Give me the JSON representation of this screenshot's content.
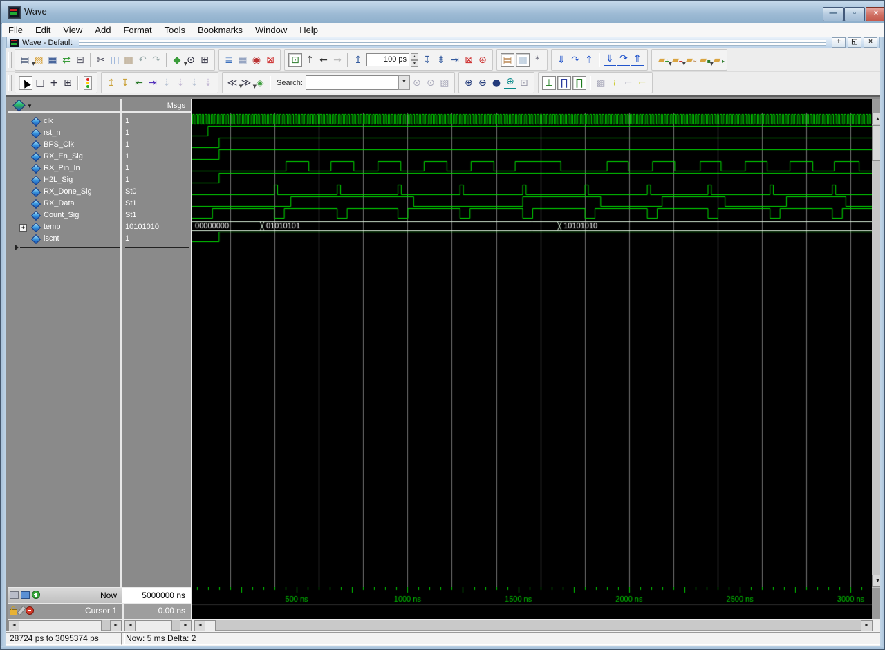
{
  "window": {
    "title": "Wave",
    "buttons": {
      "minimize": "—",
      "maximize": "▫",
      "close": "×"
    }
  },
  "menu": {
    "items": [
      "File",
      "Edit",
      "View",
      "Add",
      "Format",
      "Tools",
      "Bookmarks",
      "Window",
      "Help"
    ]
  },
  "mdi": {
    "title": "Wave - Default",
    "buttons": {
      "dock": "+",
      "undock": "◱",
      "close": "×"
    }
  },
  "toolbar1": [
    {
      "items": [
        {
          "n": "new-file-icon",
          "g": "▤",
          "c": "#4a5a7a",
          "dd": true
        },
        {
          "n": "open-icon",
          "g": "▨",
          "c": "#d49a2a"
        },
        {
          "n": "save-icon",
          "g": "▦",
          "c": "#2d4f8e"
        },
        {
          "n": "reload-icon",
          "g": "⇄",
          "c": "#3a9c3a"
        },
        {
          "n": "print-icon",
          "g": "⊟",
          "c": "#556"
        },
        {
          "sep": true
        },
        {
          "n": "cut-icon",
          "g": "✂",
          "c": "#445"
        },
        {
          "n": "copy-icon",
          "g": "◫",
          "c": "#3a6fbd"
        },
        {
          "n": "paste-icon",
          "g": "▥",
          "c": "#8a6a3a"
        },
        {
          "n": "undo-icon",
          "g": "↶",
          "c": "#9aa"
        },
        {
          "n": "redo-icon",
          "g": "↷",
          "c": "#9aa"
        },
        {
          "sep": true
        },
        {
          "n": "compile-icon",
          "g": "◆",
          "c": "#3a9c3a",
          "dd": true
        },
        {
          "n": "find-icon",
          "g": "⊙",
          "c": "#223"
        },
        {
          "n": "expand-hierarchy-icon",
          "g": "⊞",
          "c": "#334"
        }
      ]
    },
    {
      "items": [
        {
          "n": "add-to-wave-icon",
          "g": "≣",
          "c": "#3a6fbd"
        },
        {
          "n": "pattern-wizard-icon",
          "g": "▦",
          "c": "#8899bb"
        },
        {
          "n": "export-waveform-icon",
          "g": "◉",
          "c": "#b33"
        },
        {
          "n": "delete-wave-icon",
          "g": "⊠",
          "c": "#c22"
        }
      ]
    },
    {
      "items": [
        {
          "n": "link-icon",
          "g": "⊡",
          "c": "#2a7a2a",
          "box": true
        },
        {
          "n": "up-scope-icon",
          "g": "↑",
          "c": "#333"
        },
        {
          "n": "back-icon",
          "g": "←",
          "c": "#333"
        },
        {
          "n": "forward-icon",
          "g": "→",
          "c": "#bbb"
        },
        {
          "sep": true
        },
        {
          "n": "restart-icon",
          "g": "↥",
          "c": "#335a9e"
        },
        {
          "kind": "time",
          "n": "run-length-input",
          "value": "100 ps"
        },
        {
          "n": "run-icon",
          "g": "↧",
          "c": "#335a9e"
        },
        {
          "n": "run-all-icon",
          "g": "⇟",
          "c": "#335a9e"
        },
        {
          "n": "continue-run-icon",
          "g": "⇥",
          "c": "#335a9e"
        },
        {
          "n": "stop-icon",
          "g": "⊠",
          "c": "#c22"
        },
        {
          "n": "break-icon",
          "g": "⊛",
          "c": "#c33"
        }
      ]
    },
    {
      "items": [
        {
          "n": "performance-profile-icon",
          "g": "▤",
          "c": "#b85",
          "box": true
        },
        {
          "n": "memory-profile-icon",
          "g": "▥",
          "c": "#79b",
          "box": true
        },
        {
          "n": "stop-drag-icon",
          "g": "*",
          "c": "#667"
        }
      ]
    },
    {
      "items": [
        {
          "n": "insert-cursor-icon",
          "g": "⇓",
          "c": "#2255cc"
        },
        {
          "n": "restore-cursor-icon",
          "g": "↷",
          "c": "#2255cc"
        },
        {
          "n": "remove-cursor-icon",
          "g": "⇑",
          "c": "#2255cc"
        },
        {
          "sep": true
        },
        {
          "n": "insert-cursor-wave-icon",
          "g": "⇓",
          "c": "#2255cc",
          "u": true
        },
        {
          "n": "restore-cursor-wave-icon",
          "g": "↷",
          "c": "#2255cc",
          "u": true
        },
        {
          "n": "remove-cursor-wave-icon",
          "g": "⇑",
          "c": "#2255cc",
          "u": true
        }
      ]
    },
    {
      "items": [
        {
          "n": "add-window-pane-icon",
          "g": "▰",
          "c": "#d9a441",
          "badge": "+",
          "bc": "#1c8a1c",
          "dd": true
        },
        {
          "n": "remove-window-pane-icon",
          "g": "▰",
          "c": "#d9a441",
          "badge": "−",
          "bc": "#c22",
          "dd": true
        },
        {
          "n": "edit-window-pane-icon",
          "g": "▰",
          "c": "#d9a441",
          "badge": "~",
          "bc": "#b85"
        },
        {
          "n": "save-format-icon",
          "g": "▰",
          "c": "#d9a441",
          "badge": "▪",
          "bc": "#2a7a2a",
          "dd": true
        },
        {
          "n": "open-format-icon",
          "g": "▰",
          "c": "#d9a441",
          "badge": "▸",
          "bc": "#2a7a2a"
        }
      ]
    }
  ],
  "toolbar2": [
    {
      "items": [
        {
          "n": "select-mode-icon",
          "g": "▲",
          "c": "#000",
          "box": true,
          "rot": -28
        },
        {
          "n": "zoom-mode-icon",
          "g": "□",
          "c": "#334"
        },
        {
          "n": "pan-mode-icon",
          "g": "+",
          "c": "#334"
        },
        {
          "n": "edit-mode-icon",
          "g": "⊞",
          "c": "#334"
        },
        {
          "sep": true
        },
        {
          "kind": "traffic",
          "n": "stop-sim-icon"
        }
      ]
    },
    {
      "items": [
        {
          "n": "insert-rise-edge-icon",
          "g": "↥",
          "c": "#caa23a"
        },
        {
          "n": "insert-fall-edge-icon",
          "g": "↧",
          "c": "#caa23a"
        },
        {
          "n": "previous-transition-icon",
          "g": "⇤",
          "c": "#2a7a2a"
        },
        {
          "n": "next-transition-icon",
          "g": "⇥",
          "c": "#5533bb"
        },
        {
          "n": "previous-rise-icon",
          "g": "⇣",
          "c": "#b9c4d4"
        },
        {
          "n": "next-rise-icon",
          "g": "⇣",
          "c": "#c4b9d4"
        },
        {
          "n": "previous-fall-icon",
          "g": "⇣",
          "c": "#b9c4d4"
        },
        {
          "n": "next-fall-icon",
          "g": "⇣",
          "c": "#c4b9d4"
        }
      ]
    },
    {
      "items": [
        {
          "n": "collapse-left-icon",
          "g": "≪",
          "c": "#445",
          "dd": true
        },
        {
          "n": "collapse-right-icon",
          "g": "≫",
          "c": "#445",
          "dd": true
        },
        {
          "n": "expand-all-icon",
          "g": "◈",
          "c": "#3a9c3a"
        },
        {
          "sep": true
        },
        {
          "kind": "label",
          "n": "search-label",
          "text": "Search:"
        },
        {
          "kind": "search",
          "n": "search-input",
          "value": "",
          "placeholder": ""
        },
        {
          "kind": "searchdd",
          "n": "search-dropdown",
          "g": "▼"
        },
        {
          "n": "search-next-icon",
          "g": "⊙",
          "c": "#aab"
        },
        {
          "n": "search-previous-icon",
          "g": "⊙",
          "c": "#aab"
        },
        {
          "n": "search-options-icon",
          "g": "▨",
          "c": "#aab"
        }
      ]
    },
    {
      "items": [
        {
          "n": "zoom-in-icon",
          "g": "⊕",
          "c": "#223a7a"
        },
        {
          "n": "zoom-out-icon",
          "g": "⊖",
          "c": "#223a7a"
        },
        {
          "n": "zoom-full-icon",
          "g": "●",
          "c": "#223a7a"
        },
        {
          "n": "zoom-cursor-icon",
          "g": "⊕",
          "c": "#0a8a8a",
          "u": true
        },
        {
          "n": "zoom-range-icon",
          "g": "⊡",
          "c": "#99a"
        }
      ]
    },
    {
      "items": [
        {
          "n": "event-mode-icon",
          "g": "⊥",
          "c": "#1a7a1a",
          "box": true
        },
        {
          "n": "logic-mode-icon",
          "g": "∏",
          "c": "#2a3a9e",
          "box": true
        },
        {
          "n": "literal-mode-icon",
          "g": "∏",
          "c": "#1a7a1a",
          "box": true
        },
        {
          "sep": true
        },
        {
          "n": "grid-display-icon",
          "g": "▩",
          "c": "#aab"
        },
        {
          "n": "timeline-display-icon",
          "g": "≀",
          "c": "#cc3"
        },
        {
          "n": "expanded-time-icon",
          "g": "⌐",
          "c": "#aab"
        },
        {
          "n": "expanded-time-last-icon",
          "g": "⌐",
          "c": "#cc3"
        }
      ]
    }
  ],
  "wave": {
    "msgs_header": "Msgs",
    "signals": [
      {
        "name": "clk",
        "value": "1"
      },
      {
        "name": "rst_n",
        "value": "1"
      },
      {
        "name": "BPS_Clk",
        "value": "1"
      },
      {
        "name": "RX_En_Sig",
        "value": "1"
      },
      {
        "name": "RX_Pin_In",
        "value": "1"
      },
      {
        "name": "H2L_Sig",
        "value": "1"
      },
      {
        "name": "RX_Done_Sig",
        "value": "St0"
      },
      {
        "name": "RX_Data",
        "value": "St1"
      },
      {
        "name": "Count_Sig",
        "value": "St1"
      },
      {
        "name": "temp",
        "value": "10101010",
        "expandable": true
      },
      {
        "name": "iscnt",
        "value": "1"
      }
    ],
    "bottom": {
      "now_label": "Now",
      "now_value": "5000000 ns",
      "cursor_label": "Cursor 1",
      "cursor_value": "0.00 ns"
    }
  },
  "waveform": {
    "t_start": 28.724,
    "t_end": 3095.374,
    "grid_step": 200,
    "colors": {
      "signal": "#00e100",
      "grid": "#757575",
      "bus_rail": "#d9efd9",
      "bus_text": "#ffffff",
      "timeline": "#00cc00",
      "background": "#000000"
    },
    "signals": [
      {
        "name": "clk",
        "kind": "clock",
        "period": 14,
        "first_rise": 31
      },
      {
        "name": "rst_n",
        "kind": "logic",
        "transitions": [
          [
            29,
            0
          ],
          [
            100,
            1
          ]
        ]
      },
      {
        "name": "BPS_Clk",
        "kind": "logic",
        "transitions": [
          [
            29,
            0
          ],
          [
            150,
            1
          ]
        ]
      },
      {
        "name": "RX_En_Sig",
        "kind": "logic",
        "transitions": [
          [
            29,
            0
          ],
          [
            150,
            1
          ]
        ]
      },
      {
        "name": "RX_Pin_In",
        "kind": "logic",
        "transitions": [
          [
            29,
            0
          ],
          [
            452,
            1
          ],
          [
            555,
            0
          ],
          [
            655,
            1
          ],
          [
            758,
            0
          ],
          [
            867,
            1
          ],
          [
            970,
            0
          ],
          [
            1075,
            1
          ],
          [
            1178,
            0
          ],
          [
            1287,
            1
          ],
          [
            1390,
            0
          ],
          [
            1486,
            1
          ],
          [
            1692,
            0
          ],
          [
            1901,
            1
          ],
          [
            1997,
            0
          ],
          [
            2106,
            1
          ],
          [
            2206,
            0
          ],
          [
            2321,
            1
          ],
          [
            2415,
            0
          ],
          [
            2524,
            1
          ],
          [
            2623,
            0
          ],
          [
            2726,
            1
          ],
          [
            2829,
            0
          ],
          [
            2926,
            1
          ],
          [
            3038,
            0
          ]
        ]
      },
      {
        "name": "H2L_Sig",
        "kind": "logic",
        "transitions": [
          [
            29,
            0
          ],
          [
            150,
            1
          ]
        ]
      },
      {
        "name": "RX_Done_Sig",
        "kind": "logic",
        "transitions": [
          [
            29,
            0
          ],
          [
            399,
            1
          ],
          [
            414,
            0
          ],
          [
            683,
            1
          ],
          [
            698,
            0
          ],
          [
            957,
            1
          ],
          [
            972,
            0
          ],
          [
            1237,
            1
          ],
          [
            1252,
            0
          ],
          [
            1520,
            1
          ],
          [
            1535,
            0
          ],
          [
            1801,
            1
          ],
          [
            1816,
            0
          ],
          [
            2082,
            1
          ],
          [
            2097,
            0
          ],
          [
            2356,
            1
          ],
          [
            2371,
            0
          ],
          [
            2636,
            1
          ],
          [
            2651,
            0
          ],
          [
            2917,
            1
          ],
          [
            2932,
            0
          ]
        ]
      },
      {
        "name": "RX_Data",
        "kind": "logic",
        "transitions": [
          [
            29,
            0
          ],
          [
            474,
            1
          ],
          [
            1028,
            0
          ],
          [
            1520,
            1
          ],
          [
            1872,
            0
          ],
          [
            2149,
            1
          ],
          [
            2433,
            0
          ],
          [
            2710,
            1
          ],
          [
            2978,
            0
          ]
        ]
      },
      {
        "name": "Count_Sig",
        "kind": "logic",
        "transitions": [
          [
            29,
            0
          ],
          [
            120,
            1
          ],
          [
            399,
            0
          ],
          [
            444,
            1
          ],
          [
            683,
            0
          ],
          [
            728,
            1
          ],
          [
            957,
            0
          ],
          [
            1002,
            1
          ],
          [
            1237,
            0
          ],
          [
            1282,
            1
          ],
          [
            1520,
            0
          ],
          [
            1565,
            1
          ],
          [
            1801,
            0
          ],
          [
            1846,
            1
          ],
          [
            2082,
            0
          ],
          [
            2127,
            1
          ],
          [
            2356,
            0
          ],
          [
            2401,
            1
          ],
          [
            2636,
            0
          ],
          [
            2681,
            1
          ],
          [
            2917,
            0
          ],
          [
            2962,
            1
          ]
        ]
      },
      {
        "name": "temp",
        "kind": "bus",
        "segments": [
          [
            29,
            "00000000"
          ],
          [
            344,
            "01010101"
          ],
          [
            1686,
            "10101010"
          ]
        ]
      },
      {
        "name": "iscnt",
        "kind": "logic",
        "transitions": [
          [
            29,
            0
          ],
          [
            150,
            1
          ]
        ]
      }
    ],
    "timeline": {
      "minor_step": 50,
      "major_step": 250,
      "labels": [
        [
          500,
          "500 ns"
        ],
        [
          1000,
          "1000 ns"
        ],
        [
          1500,
          "1500 ns"
        ],
        [
          2000,
          "2000 ns"
        ],
        [
          2500,
          "2500 ns"
        ],
        [
          3000,
          "3000 ns"
        ]
      ]
    }
  },
  "statusbar": {
    "range": "28724 ps to 3095374 ps",
    "now_delta": "Now: 5 ms  Delta: 2"
  }
}
